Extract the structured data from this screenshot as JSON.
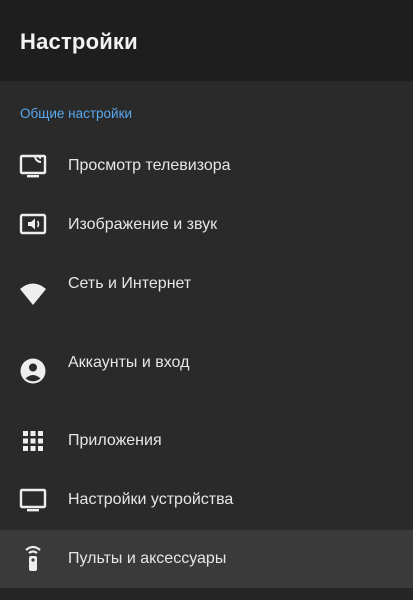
{
  "header": {
    "title": "Настройки"
  },
  "section": {
    "title": "Общие настройки"
  },
  "items": [
    {
      "label": "Просмотр телевизора",
      "icon": "tv-cast-icon"
    },
    {
      "label": "Изображение и звук",
      "icon": "picture-sound-icon"
    },
    {
      "label": "Сеть и Интернет",
      "icon": "wifi-icon"
    },
    {
      "label": "Аккаунты и вход",
      "icon": "account-icon"
    },
    {
      "label": "Приложения",
      "icon": "apps-grid-icon"
    },
    {
      "label": "Настройки устройства",
      "icon": "monitor-icon"
    },
    {
      "label": "Пульты и аксессуары",
      "icon": "remote-icon"
    }
  ],
  "selected_item": "Пульты и аксессуары"
}
